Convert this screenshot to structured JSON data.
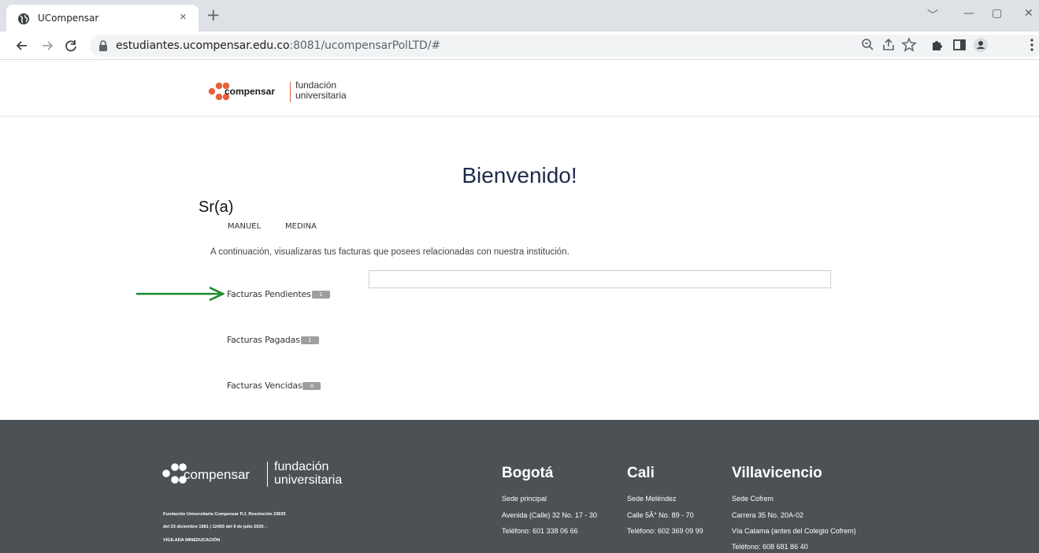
{
  "browser": {
    "tab_title": "UCompensar",
    "tab_close": "×",
    "new_tab": "+",
    "url_host": "estudiantes.ucompensar.edu.co",
    "url_path": ":8081/ucompensarPolLTD/#",
    "window_controls": [
      "﹀",
      "—",
      "▢",
      "✕"
    ]
  },
  "header": {
    "logo_wordmark": "compensar",
    "logo_line1": "fundación",
    "logo_line2": "universitaria"
  },
  "main": {
    "welcome": "Bienvenido!",
    "salutation": "Sr(a)",
    "first_name": "MANUEL",
    "last_name": "MEDINA",
    "intro": "A continuación, visualizaras tus facturas que posees relacionadas con nuestra institución.",
    "invoices": [
      {
        "label": "Facturas Pendientes",
        "count": "1"
      },
      {
        "label": "Facturas Pagadas",
        "count": "1"
      },
      {
        "label": "Facturas Vencidas",
        "count": "0"
      }
    ]
  },
  "footer": {
    "logo_wordmark": "compensar",
    "logo_line1": "fundación",
    "logo_line2": "universitaria",
    "legal": [
      "Fundación Universitaria Compensar P.J. Resolución 23635",
      "del 23 diciembre 1981 | 12455 del 9 de julio 2020. -",
      "VIGILADA MINEDUCACIÓN"
    ],
    "cities": [
      {
        "name": "Bogotá",
        "lines": [
          "Sede principal",
          "Avenida (Calle) 32 No. 17 - 30",
          "Teléfono: 601 338 06 66"
        ]
      },
      {
        "name": "Cali",
        "lines": [
          "Sede Meléndez",
          "Calle 5Â° No. 89 - 70",
          "Teléfono: 602 369 09 99"
        ]
      },
      {
        "name": "Villavicencio",
        "lines": [
          "Sede Cofrem",
          "Carrera 35 No. 20A-02",
          "Vía Catama (antes del Colegio Cofrem)",
          "Teléfono: 608 681 86 40"
        ]
      }
    ]
  },
  "colors": {
    "brand_orange": "#e8613a",
    "welcome_navy": "#1e2b4a",
    "footer_bg": "#4b5155",
    "arrow_green": "#1a8a2f"
  }
}
